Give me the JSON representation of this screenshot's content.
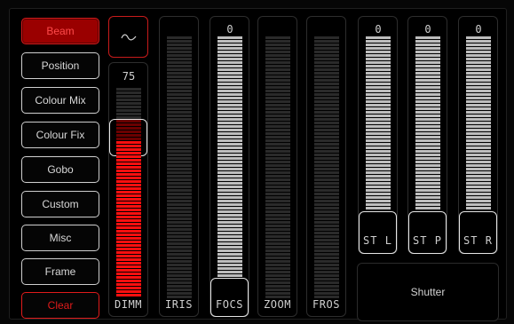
{
  "menu": {
    "items": [
      {
        "label": "Beam",
        "active": true
      },
      {
        "label": "Position",
        "active": false
      },
      {
        "label": "Colour Mix",
        "active": false
      },
      {
        "label": "Colour Fix",
        "active": false
      },
      {
        "label": "Gobo",
        "active": false
      },
      {
        "label": "Custom",
        "active": false
      },
      {
        "label": "Misc",
        "active": false
      },
      {
        "label": "Frame",
        "active": false
      }
    ],
    "clear_label": "Clear"
  },
  "beam": {
    "mode_icon": "wave-icon",
    "dimmer": {
      "label": "DIMM",
      "value": "75",
      "level": 0.75
    },
    "iris": {
      "label": "IRIS",
      "value": "",
      "level": 0
    },
    "focus": {
      "label": "FOCS",
      "value": "0",
      "level": 0
    },
    "zoom": {
      "label": "ZOOM",
      "value": "",
      "level": 0
    },
    "frost": {
      "label": "FROS",
      "value": "",
      "level": 0
    }
  },
  "shutter": {
    "title": "Shutter",
    "channels": [
      {
        "label": "ST L",
        "value": "0",
        "level": 0
      },
      {
        "label": "ST P",
        "value": "0",
        "level": 0
      },
      {
        "label": "ST R",
        "value": "0",
        "level": 0
      }
    ]
  },
  "colors": {
    "accent_red": "#ff0f0f",
    "active_bg": "#9a0000",
    "border_grey": "#2d2d2d"
  }
}
